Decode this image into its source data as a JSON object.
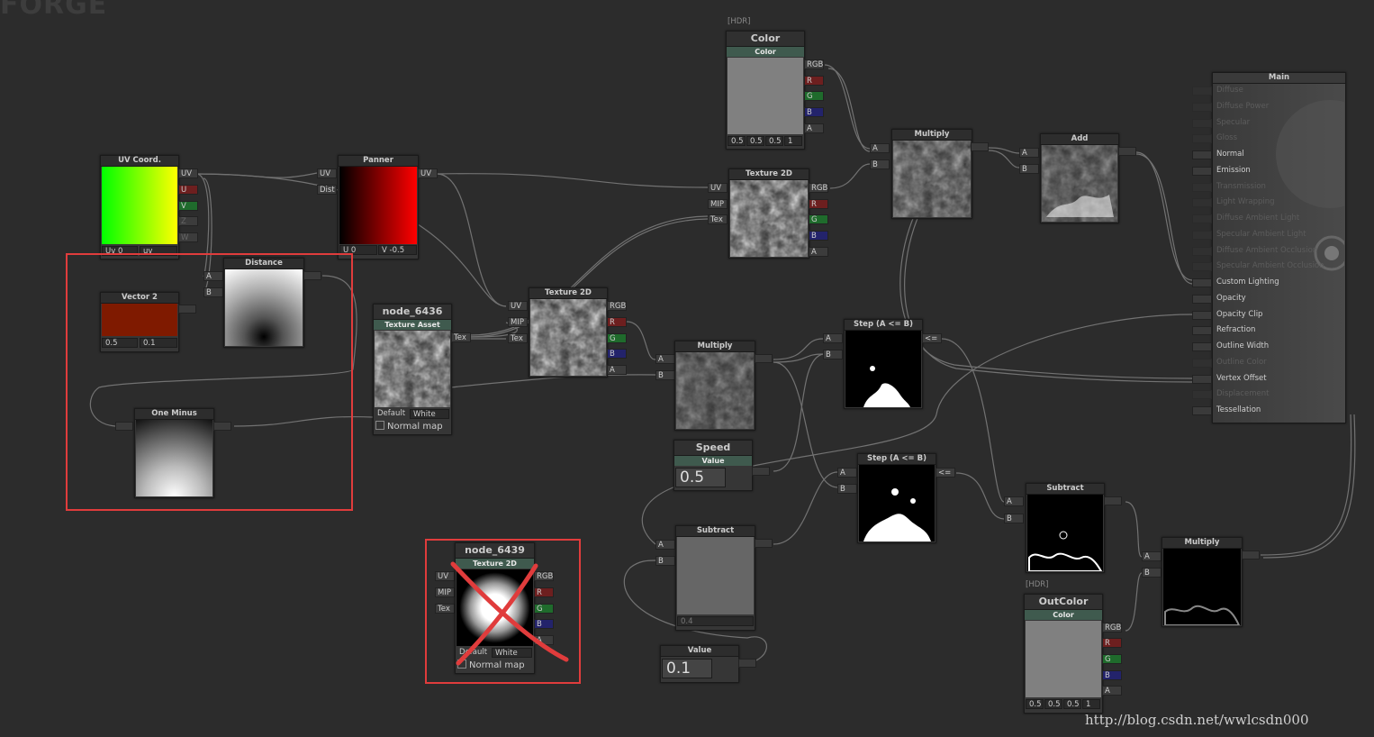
{
  "app": {
    "logo": "FORGE",
    "watermark": "http://blog.csdn.net/wwlcsdn000"
  },
  "ports": {
    "uv": "UV",
    "u": "U",
    "v": "V",
    "z": "Z",
    "w": "W",
    "a": "A",
    "b": "B",
    "rgb": "RGB",
    "r": "R",
    "g": "G",
    "bb": "B",
    "aa": "A",
    "mip": "MIP",
    "tex": "Tex",
    "dist": "Dist",
    "le": "<="
  },
  "color_node": {
    "hdr_tag": "[HDR]",
    "title": "Color",
    "subtitle": "Color",
    "values": [
      "0.5",
      "0.5",
      "0.5",
      "1"
    ]
  },
  "uv_coord": {
    "title": "UV Coord.",
    "field1": "Uv 0",
    "field2": "uv"
  },
  "panner": {
    "title": "Panner",
    "u_label": "U 0",
    "v_label": "V -0.5"
  },
  "texture2d_top": {
    "title": "Texture 2D"
  },
  "multiply_top": {
    "title": "Multiply"
  },
  "add": {
    "title": "Add"
  },
  "distance": {
    "title": "Distance"
  },
  "vector2": {
    "title": "Vector 2",
    "x": "0.5",
    "y": "0.1"
  },
  "one_minus": {
    "title": "One Minus"
  },
  "node_6436": {
    "title": "node_6436",
    "subtitle": "Texture Asset",
    "default_label": "Default",
    "default_value": "White",
    "normal_map": "Normal map"
  },
  "texture2d_mid": {
    "title": "Texture 2D"
  },
  "multiply_mid": {
    "title": "Multiply"
  },
  "step1": {
    "title": "Step (A <= B)"
  },
  "step2": {
    "title": "Step (A <= B)"
  },
  "speed": {
    "title": "Speed",
    "subtitle": "Value",
    "value": "0.5"
  },
  "subtract_mid": {
    "title": "Subtract",
    "value": "0.4"
  },
  "value_node": {
    "title": "Value",
    "value": "0.1"
  },
  "subtract_right": {
    "title": "Subtract"
  },
  "multiply_right": {
    "title": "Multiply"
  },
  "outcolor": {
    "hdr_tag": "[HDR]",
    "title": "OutColor",
    "subtitle": "Color",
    "values": [
      "0.5",
      "0.5",
      "0.5",
      "1"
    ]
  },
  "node_6439": {
    "title": "node_6439",
    "subtitle": "Texture 2D",
    "default_label": "Default",
    "default_value": "White",
    "normal_map": "Normal map"
  },
  "main": {
    "title": "Main",
    "inputs": [
      {
        "label": "Diffuse",
        "active": false
      },
      {
        "label": "Diffuse Power",
        "active": false
      },
      {
        "label": "Specular",
        "active": false
      },
      {
        "label": "Gloss",
        "active": false
      },
      {
        "label": "Normal",
        "active": true
      },
      {
        "label": "Emission",
        "active": true
      },
      {
        "label": "Transmission",
        "active": false
      },
      {
        "label": "Light Wrapping",
        "active": false
      },
      {
        "label": "Diffuse Ambient Light",
        "active": false
      },
      {
        "label": "Specular Ambient Light",
        "active": false
      },
      {
        "label": "Diffuse Ambient Occlusion",
        "active": false
      },
      {
        "label": "Specular Ambient Occlusion",
        "active": false
      },
      {
        "label": "Custom Lighting",
        "active": true
      },
      {
        "label": "Opacity",
        "active": true
      },
      {
        "label": "Opacity Clip",
        "active": true
      },
      {
        "label": "Refraction",
        "active": true
      },
      {
        "label": "Outline Width",
        "active": true
      },
      {
        "label": "Outline Color",
        "active": false
      },
      {
        "label": "Vertex Offset",
        "active": true
      },
      {
        "label": "Displacement",
        "active": false
      },
      {
        "label": "Tessellation",
        "active": true
      }
    ]
  },
  "colors": {
    "background": "#2c2c2c",
    "node_header": "#2d2d2d",
    "subheader": "#3f5a4e",
    "port_r": "#6d1f1f",
    "port_g": "#1f6b2c",
    "port_b": "#23236b",
    "annotation": "#e03c3c",
    "wire": "#8a8a8a"
  }
}
